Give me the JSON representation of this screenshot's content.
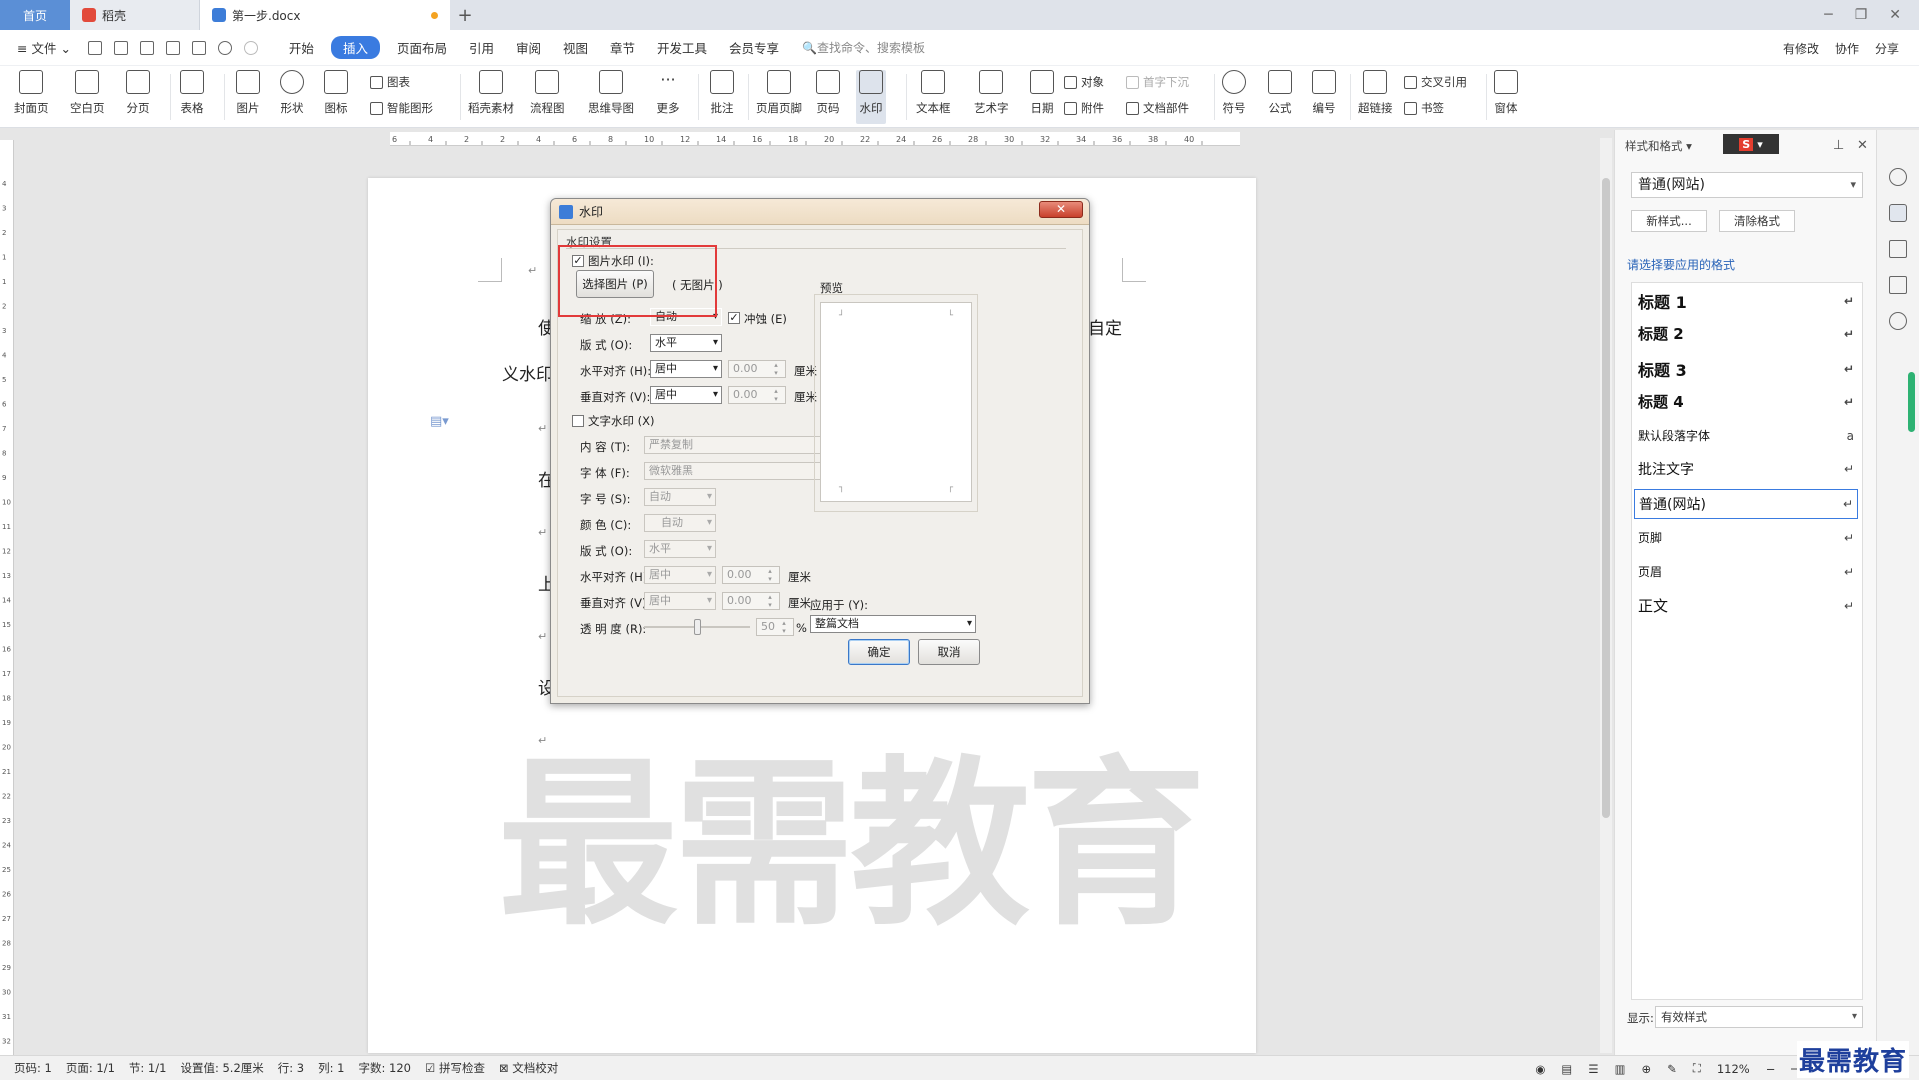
{
  "tabs": {
    "home": "首页",
    "daoke": "稻壳",
    "doc": "第一步.docx",
    "add": "+"
  },
  "window_controls": {
    "min": "─",
    "max": "❐",
    "close": "✕"
  },
  "menu": {
    "file": "文件",
    "items": [
      "开始",
      "插入",
      "页面布局",
      "引用",
      "审阅",
      "视图",
      "章节",
      "开发工具",
      "会员专享"
    ],
    "search": "查找命令、搜索模板",
    "right": [
      "有修改",
      "协作",
      "分享"
    ]
  },
  "ribbon": {
    "big": [
      "封面页",
      "空白页",
      "分页",
      "表格",
      "图片",
      "形状",
      "图标",
      "稻壳素材",
      "流程图",
      "思维导图",
      "更多",
      "批注",
      "页眉页脚",
      "页码",
      "水印",
      "文本框",
      "艺术字",
      "日期",
      "符号",
      "公式",
      "编号",
      "超链接",
      "窗体"
    ],
    "small": {
      "chart": "图表",
      "smart": "智能图形",
      "object": "对象",
      "dropcap": "首字下沉",
      "attach": "附件",
      "docpart": "文档部件",
      "crossref": "交叉引用",
      "bookmark": "书签"
    }
  },
  "ruler": {
    "h_ticks": [
      "6",
      "4",
      "2",
      "2",
      "4",
      "6",
      "8",
      "10",
      "12",
      "14",
      "16",
      "18",
      "20",
      "22",
      "24",
      "26",
      "28",
      "30",
      "32",
      "34",
      "36",
      "38",
      "40"
    ],
    "v_ticks": [
      "4",
      "3",
      "2",
      "1",
      "1",
      "2",
      "3",
      "4",
      "5",
      "6",
      "7",
      "8",
      "9",
      "10",
      "11",
      "12",
      "13",
      "14",
      "15",
      "16",
      "17",
      "18",
      "19",
      "20",
      "21",
      "22",
      "23",
      "24",
      "25",
      "26",
      "27",
      "28",
      "29",
      "30",
      "31",
      "32"
    ]
  },
  "document": {
    "line1_left": "使",
    "line1_right": "自定",
    "line2": "义水印",
    "line3": "在",
    "line4": "上",
    "line5": "设",
    "para_mark": "↵",
    "watermark": "最需教育"
  },
  "dialog": {
    "title": "水印",
    "close": "✕",
    "group": "水印设置",
    "image_wm": {
      "label": "图片水印 (I):",
      "checked": true,
      "select_btn": "选择图片 (P)",
      "no_image": "( 无图片 )",
      "scale_label": "缩    放 (Z):",
      "scale": "自动",
      "washout_label": "冲蚀 (E)",
      "washout": true,
      "layout_label": "版    式 (O):",
      "layout": "水平",
      "halign_label": "水平对齐 (H):",
      "halign": "居中",
      "halign_num": "0.00",
      "valign_label": "垂直对齐 (V):",
      "valign": "居中",
      "valign_num": "0.00",
      "unit": "厘米"
    },
    "text_wm": {
      "label": "文字水印 (X)",
      "checked": false,
      "content_label": "内    容 (T):",
      "content": "严禁复制",
      "font_label": "字    体 (F):",
      "font": "微软雅黑",
      "size_label": "字    号 (S):",
      "size": "自动",
      "color_label": "颜    色 (C):",
      "color": "自动",
      "layout_label": "版    式 (O):",
      "layout": "水平",
      "halign_label": "水平对齐 (H):",
      "halign": "居中",
      "halign_num": "0.00",
      "valign_label": "垂直对齐 (V):",
      "valign": "居中",
      "valign_num": "0.00",
      "unit": "厘米",
      "opacity_label": "透 明 度 (R):",
      "opacity": "50",
      "percent": "%"
    },
    "preview_label": "预览",
    "apply_label": "应用于 (Y):",
    "apply_to": "整篇文档",
    "ok": "确定",
    "cancel": "取消"
  },
  "panel": {
    "header": "样式和格式",
    "current": "普通(网站)",
    "new_style": "新样式...",
    "clear": "清除格式",
    "subtitle": "请选择要应用的格式",
    "styles": [
      {
        "name": "标题  1",
        "mark": "↵"
      },
      {
        "name": "标题  2",
        "mark": "↵"
      },
      {
        "name": "标题  3",
        "mark": "↵"
      },
      {
        "name": "标题  4",
        "mark": "↵"
      },
      {
        "name": "默认段落字体",
        "mark": "a"
      },
      {
        "name": "批注文字",
        "mark": "↵"
      },
      {
        "name": "普通(网站)",
        "mark": "↵"
      },
      {
        "name": "页脚",
        "mark": "↵"
      },
      {
        "name": "页眉",
        "mark": "↵"
      },
      {
        "name": "正文",
        "mark": "↵"
      }
    ],
    "show_label": "显示:",
    "show_value": "有效样式"
  },
  "status": {
    "page": "页码: 1",
    "pages": "页面: 1/1",
    "section": "节: 1/1",
    "setting": "设置值: 5.2厘米",
    "row": "行: 3",
    "col": "列: 1",
    "words": "字数: 120",
    "spell": "拼写检查",
    "proof": "文档校对",
    "zoom": "112%",
    "minus": "−",
    "plus": "+"
  },
  "corner_logo": "最需教育",
  "colors": {
    "accent": "#3a7be0",
    "highlight_red": "#e23a3a",
    "home_tab": "#5b8fd6",
    "watermark_gray": "#e0e0e0"
  }
}
